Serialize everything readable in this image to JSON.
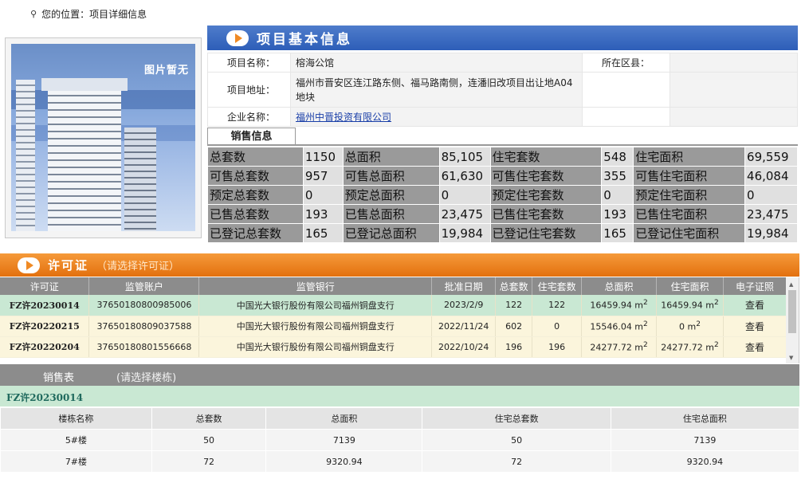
{
  "breadcrumb": {
    "text": "您的位置：项目详细信息"
  },
  "photo": {
    "placeholder": "图片暂无"
  },
  "basic_info": {
    "title": "项目基本信息",
    "project_name_label": "项目名称：",
    "project_name": "榕海公馆",
    "district_label": "所在区县：",
    "district": "",
    "address_label": "项目地址：",
    "address": "福州市晋安区连江路东侧、福马路南侧，连潘旧改项目出让地A04地块",
    "company_label": "企业名称：",
    "company": "福州中晋投资有限公司"
  },
  "sales_info": {
    "tab": "销售信息",
    "rows": [
      [
        "总套数",
        "1150",
        "总面积",
        "85,105",
        "住宅套数",
        "548",
        "住宅面积",
        "69,559"
      ],
      [
        "可售总套数",
        "957",
        "可售总面积",
        "61,630",
        "可售住宅套数",
        "355",
        "可售住宅面积",
        "46,084"
      ],
      [
        "预定总套数",
        "0",
        "预定总面积",
        "0",
        "预定住宅套数",
        "0",
        "预定住宅面积",
        "0"
      ],
      [
        "已售总套数",
        "193",
        "已售总面积",
        "23,475",
        "已售住宅套数",
        "193",
        "已售住宅面积",
        "23,475"
      ],
      [
        "已登记总套数",
        "165",
        "已登记总面积",
        "19,984",
        "已登记住宅套数",
        "165",
        "已登记住宅面积",
        "19,984"
      ]
    ]
  },
  "permits": {
    "title": "许可证",
    "hint": "（请选择许可证）",
    "columns": [
      "许可证",
      "监管账户",
      "监管银行",
      "批准日期",
      "总套数",
      "住宅套数",
      "总面积",
      "住宅面积",
      "电子证照"
    ],
    "rows": [
      {
        "id": "FZ许20230014",
        "account": "37650180800985006",
        "bank": "中国光大银行股份有限公司福州铜盘支行",
        "date": "2023/2/9",
        "total_units": "122",
        "res_units": "122",
        "total_area": "16459.94 m",
        "res_area": "16459.94 m",
        "link": "查看"
      },
      {
        "id": "FZ许20220215",
        "account": "37650180809037588",
        "bank": "中国光大银行股份有限公司福州铜盘支行",
        "date": "2022/11/24",
        "total_units": "602",
        "res_units": "0",
        "total_area": "15546.04 m",
        "res_area": "0 m",
        "link": "查看"
      },
      {
        "id": "FZ许20220204",
        "account": "37650180801556668",
        "bank": "中国光大银行股份有限公司福州铜盘支行",
        "date": "2022/10/24",
        "total_units": "196",
        "res_units": "196",
        "total_area": "24277.72 m",
        "res_area": "24277.72 m",
        "link": "查看"
      }
    ],
    "superscript": "2"
  },
  "sales_table": {
    "title": "销售表",
    "hint": "(请选择楼栋)",
    "selected_permit": "FZ许20230014",
    "columns": [
      "楼栋名称",
      "总套数",
      "总面积",
      "住宅总套数",
      "住宅总面积"
    ],
    "rows": [
      [
        "5#楼",
        "50",
        "7139",
        "50",
        "7139"
      ],
      [
        "7#楼",
        "72",
        "9320.94",
        "72",
        "9320.94"
      ]
    ]
  }
}
